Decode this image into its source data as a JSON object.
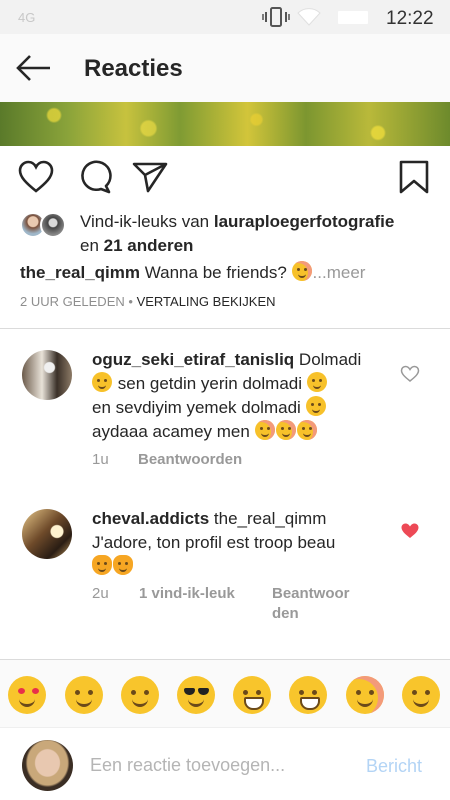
{
  "status_bar": {
    "network": "4G",
    "time": "12:22"
  },
  "header": {
    "title": "Reacties",
    "back_icon": "arrow-left-icon"
  },
  "actions": {
    "like_icon": "heart-outline-icon",
    "comment_icon": "comment-bubble-icon",
    "share_icon": "paper-plane-icon",
    "save_icon": "bookmark-icon"
  },
  "likes": {
    "prefix": "Vind-ik-leuks van",
    "user": "lauraploegerfotografie",
    "connector": "en",
    "others": "21 anderen"
  },
  "caption": {
    "user": "the_real_qimm",
    "text": "Wanna be friends?",
    "more": "...meer"
  },
  "post_meta": {
    "time": "2 UUR GELEDEN",
    "separator": "•",
    "translate": "VERTALING BEKIJKEN"
  },
  "comments": [
    {
      "user": "oguz_seki_etiraf_tanisliq",
      "text_1": "Dolmadi",
      "text_2": "sen getdin yerin dolmadi",
      "text_3": "en sevdiyim yemek dolmadi",
      "text_4": "aydaaa acamey men",
      "time": "1u",
      "reply": "Beantwoorden",
      "liked": false
    },
    {
      "user": "cheval.addicts",
      "text_1": "the_real_qimm",
      "text_2": "J'adore, ton profil est troop beau",
      "time": "2u",
      "likes": "1 vind-ik-leuk",
      "reply_1": "Beantwoor",
      "reply_2": "den",
      "liked": true
    }
  ],
  "emoji_bar": [
    "heart-eyes",
    "smile",
    "wink",
    "sunglasses",
    "tears-of-joy",
    "grin",
    "blush",
    "raised-hands"
  ],
  "comment_input": {
    "placeholder": "Een reactie toevoegen...",
    "post_label": "Bericht"
  },
  "colors": {
    "link_disabled": "#b3d4f5",
    "heart_liked": "#ed4956",
    "muted_text": "#999999"
  }
}
